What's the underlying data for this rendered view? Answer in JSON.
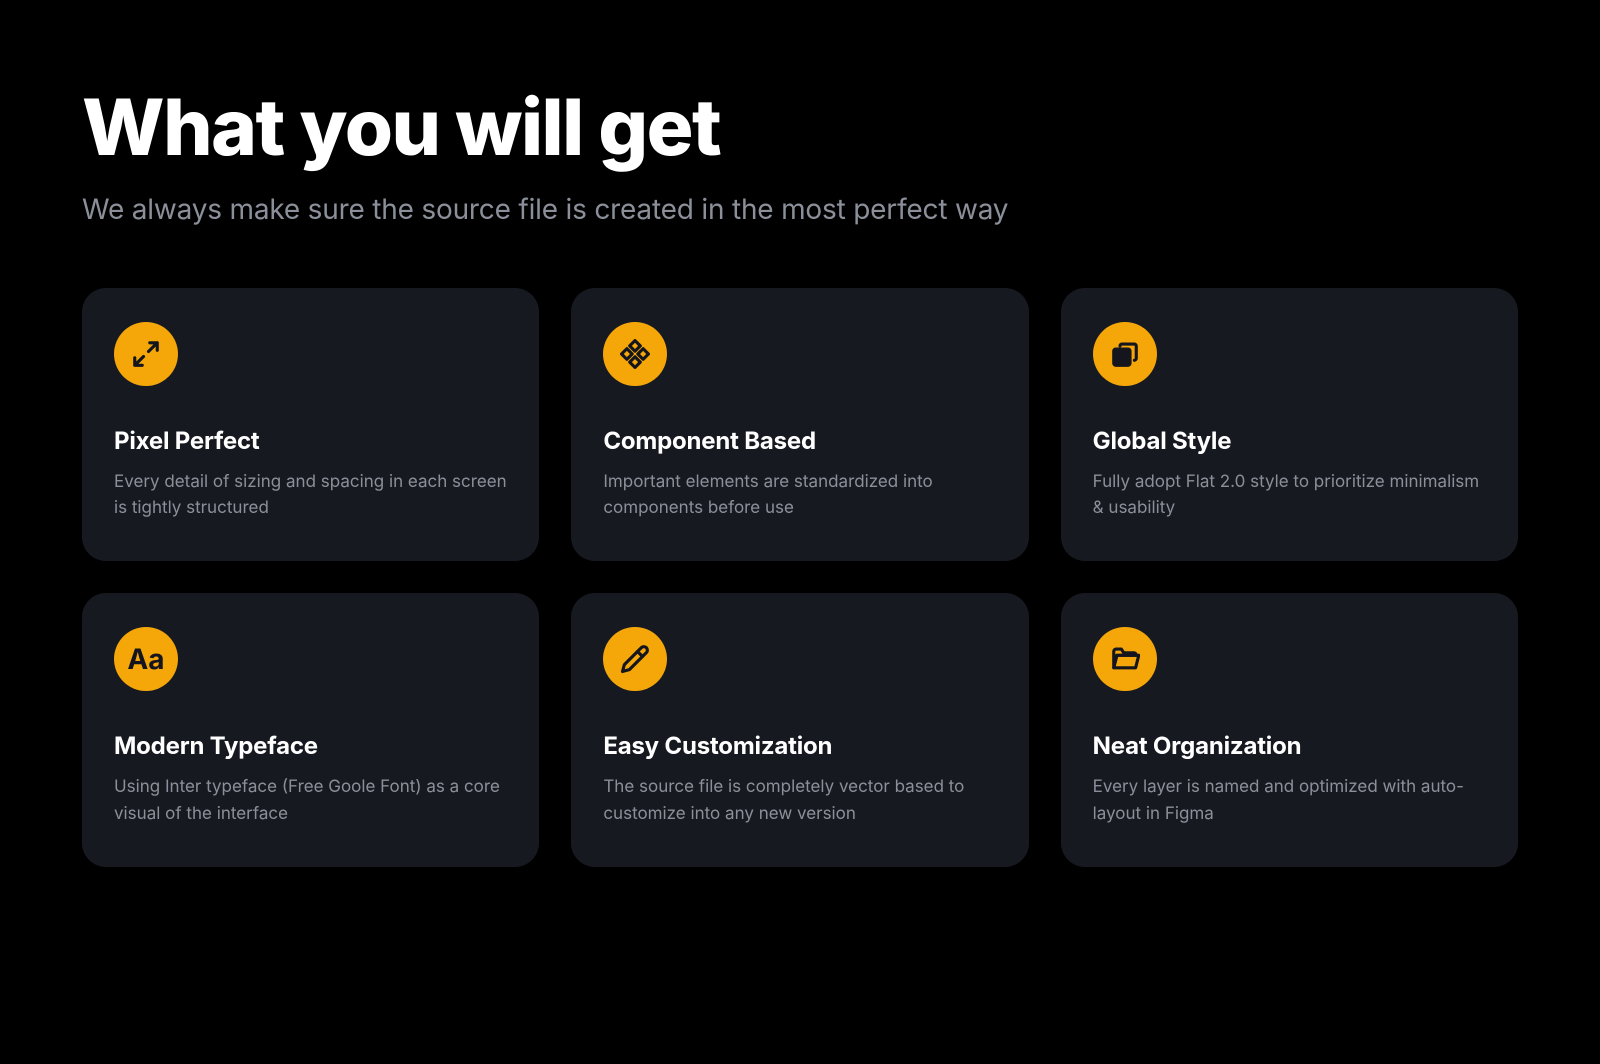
{
  "heading": "What you will get",
  "subheading": "We always make sure the source file is created in the most perfect way",
  "cards": [
    {
      "title": "Pixel Perfect",
      "desc": "Every detail of sizing and spacing in each screen is tightly structured"
    },
    {
      "title": "Component Based",
      "desc": "Important elements are standardized into components before use"
    },
    {
      "title": "Global Style",
      "desc": "Fully adopt Flat 2.0 style to prioritize minimalism & usability"
    },
    {
      "title": "Modern Typeface",
      "desc": "Using Inter typeface (Free Goole Font) as a core visual of the interface"
    },
    {
      "title": "Easy Customization",
      "desc": "The source file is completely vector based to customize into any new version"
    },
    {
      "title": "Neat Organization",
      "desc": "Every layer is named and optimized with auto-layout in Figma"
    }
  ]
}
